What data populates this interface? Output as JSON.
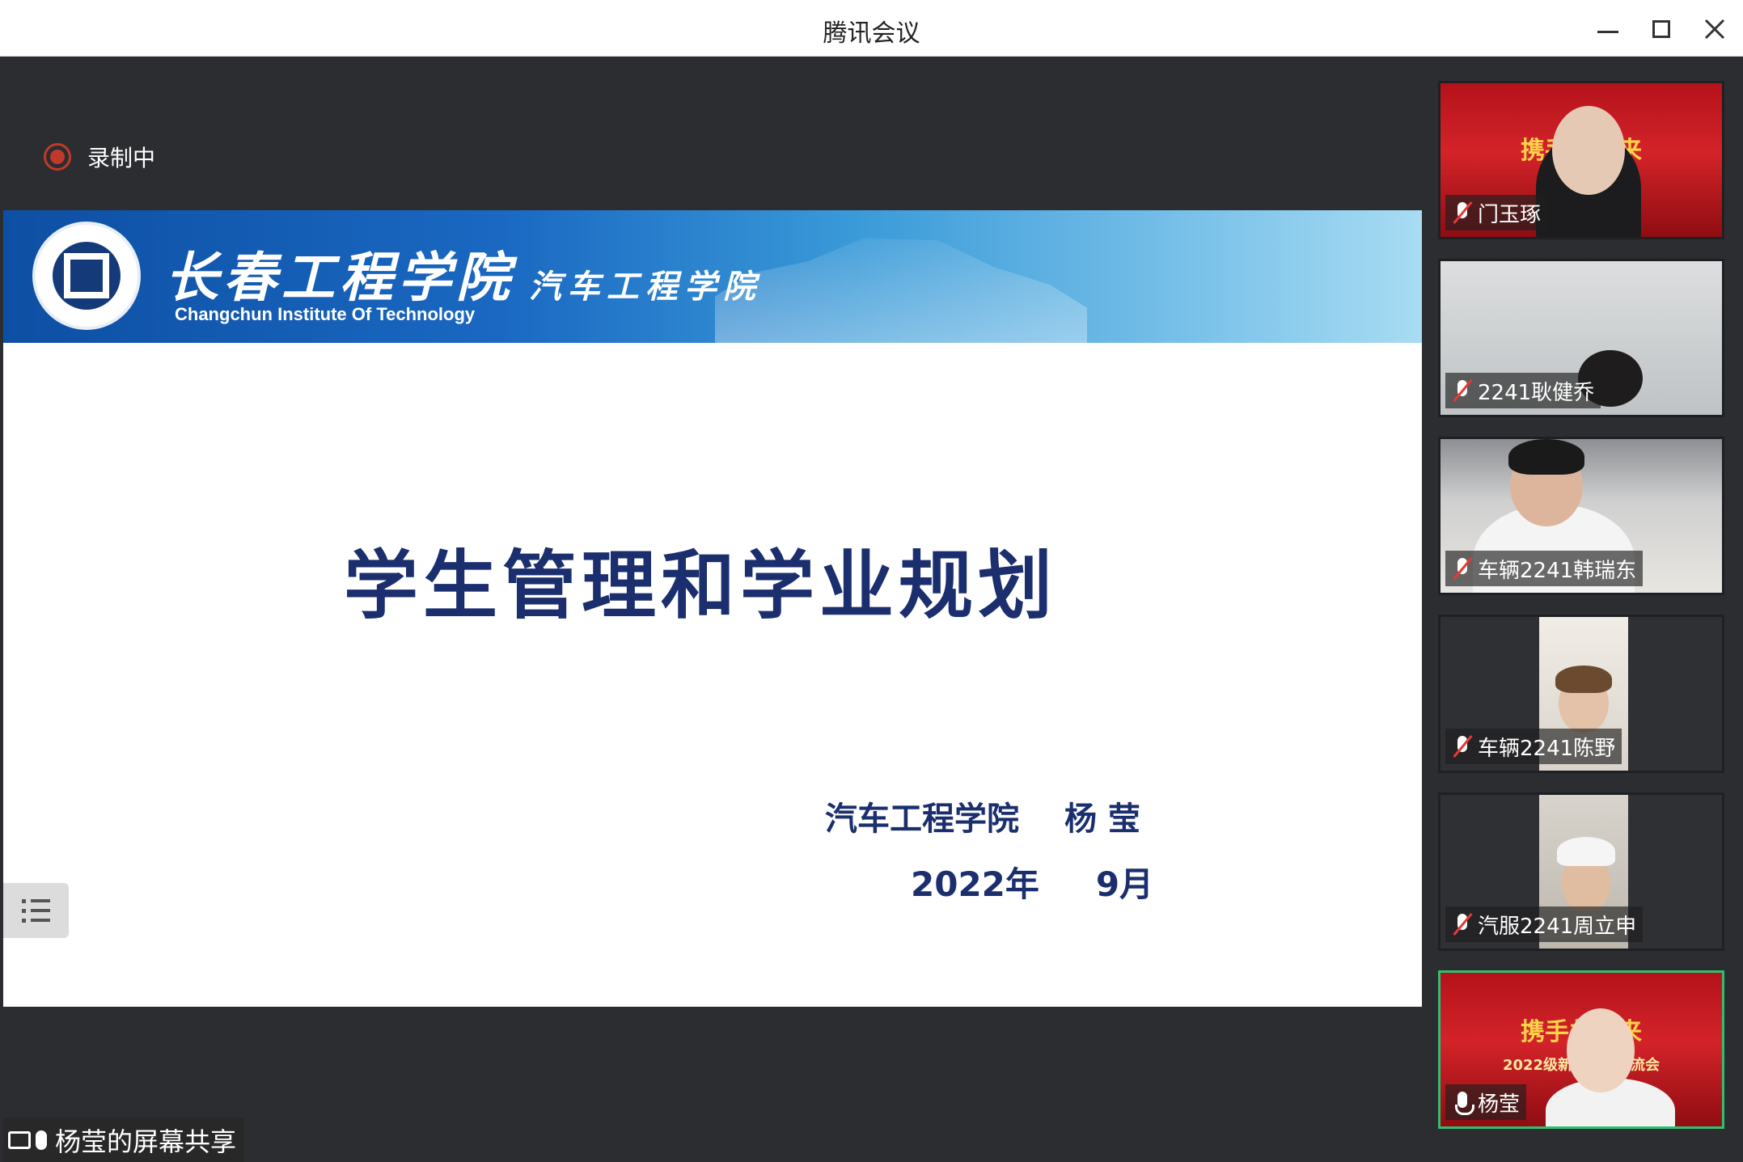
{
  "window": {
    "title": "腾讯会议"
  },
  "recording": {
    "label": "录制中"
  },
  "slide": {
    "school_cn": "长春工程学院",
    "school_en": "Changchun Institute Of Technology",
    "department": "汽车工程学院",
    "title": "学生管理和学业规划",
    "presenter_dept": "汽车工程学院",
    "presenter_name": "杨 莹",
    "date_year": "2022年",
    "date_month": "9月"
  },
  "share_label": "杨莹的屏幕共享",
  "participants": [
    {
      "name": "门玉琢",
      "mic": "muted",
      "banner_text": "携手共未来"
    },
    {
      "name": "2241耿健乔",
      "mic": "muted"
    },
    {
      "name": "车辆2241韩瑞东",
      "mic": "muted"
    },
    {
      "name": "车辆2241陈野",
      "mic": "muted"
    },
    {
      "name": "汽服2241周立申",
      "mic": "muted"
    },
    {
      "name": "杨莹",
      "mic": "on",
      "banner_text": "携手共未来",
      "banner_sub": "2022级新生见面交流会"
    }
  ]
}
